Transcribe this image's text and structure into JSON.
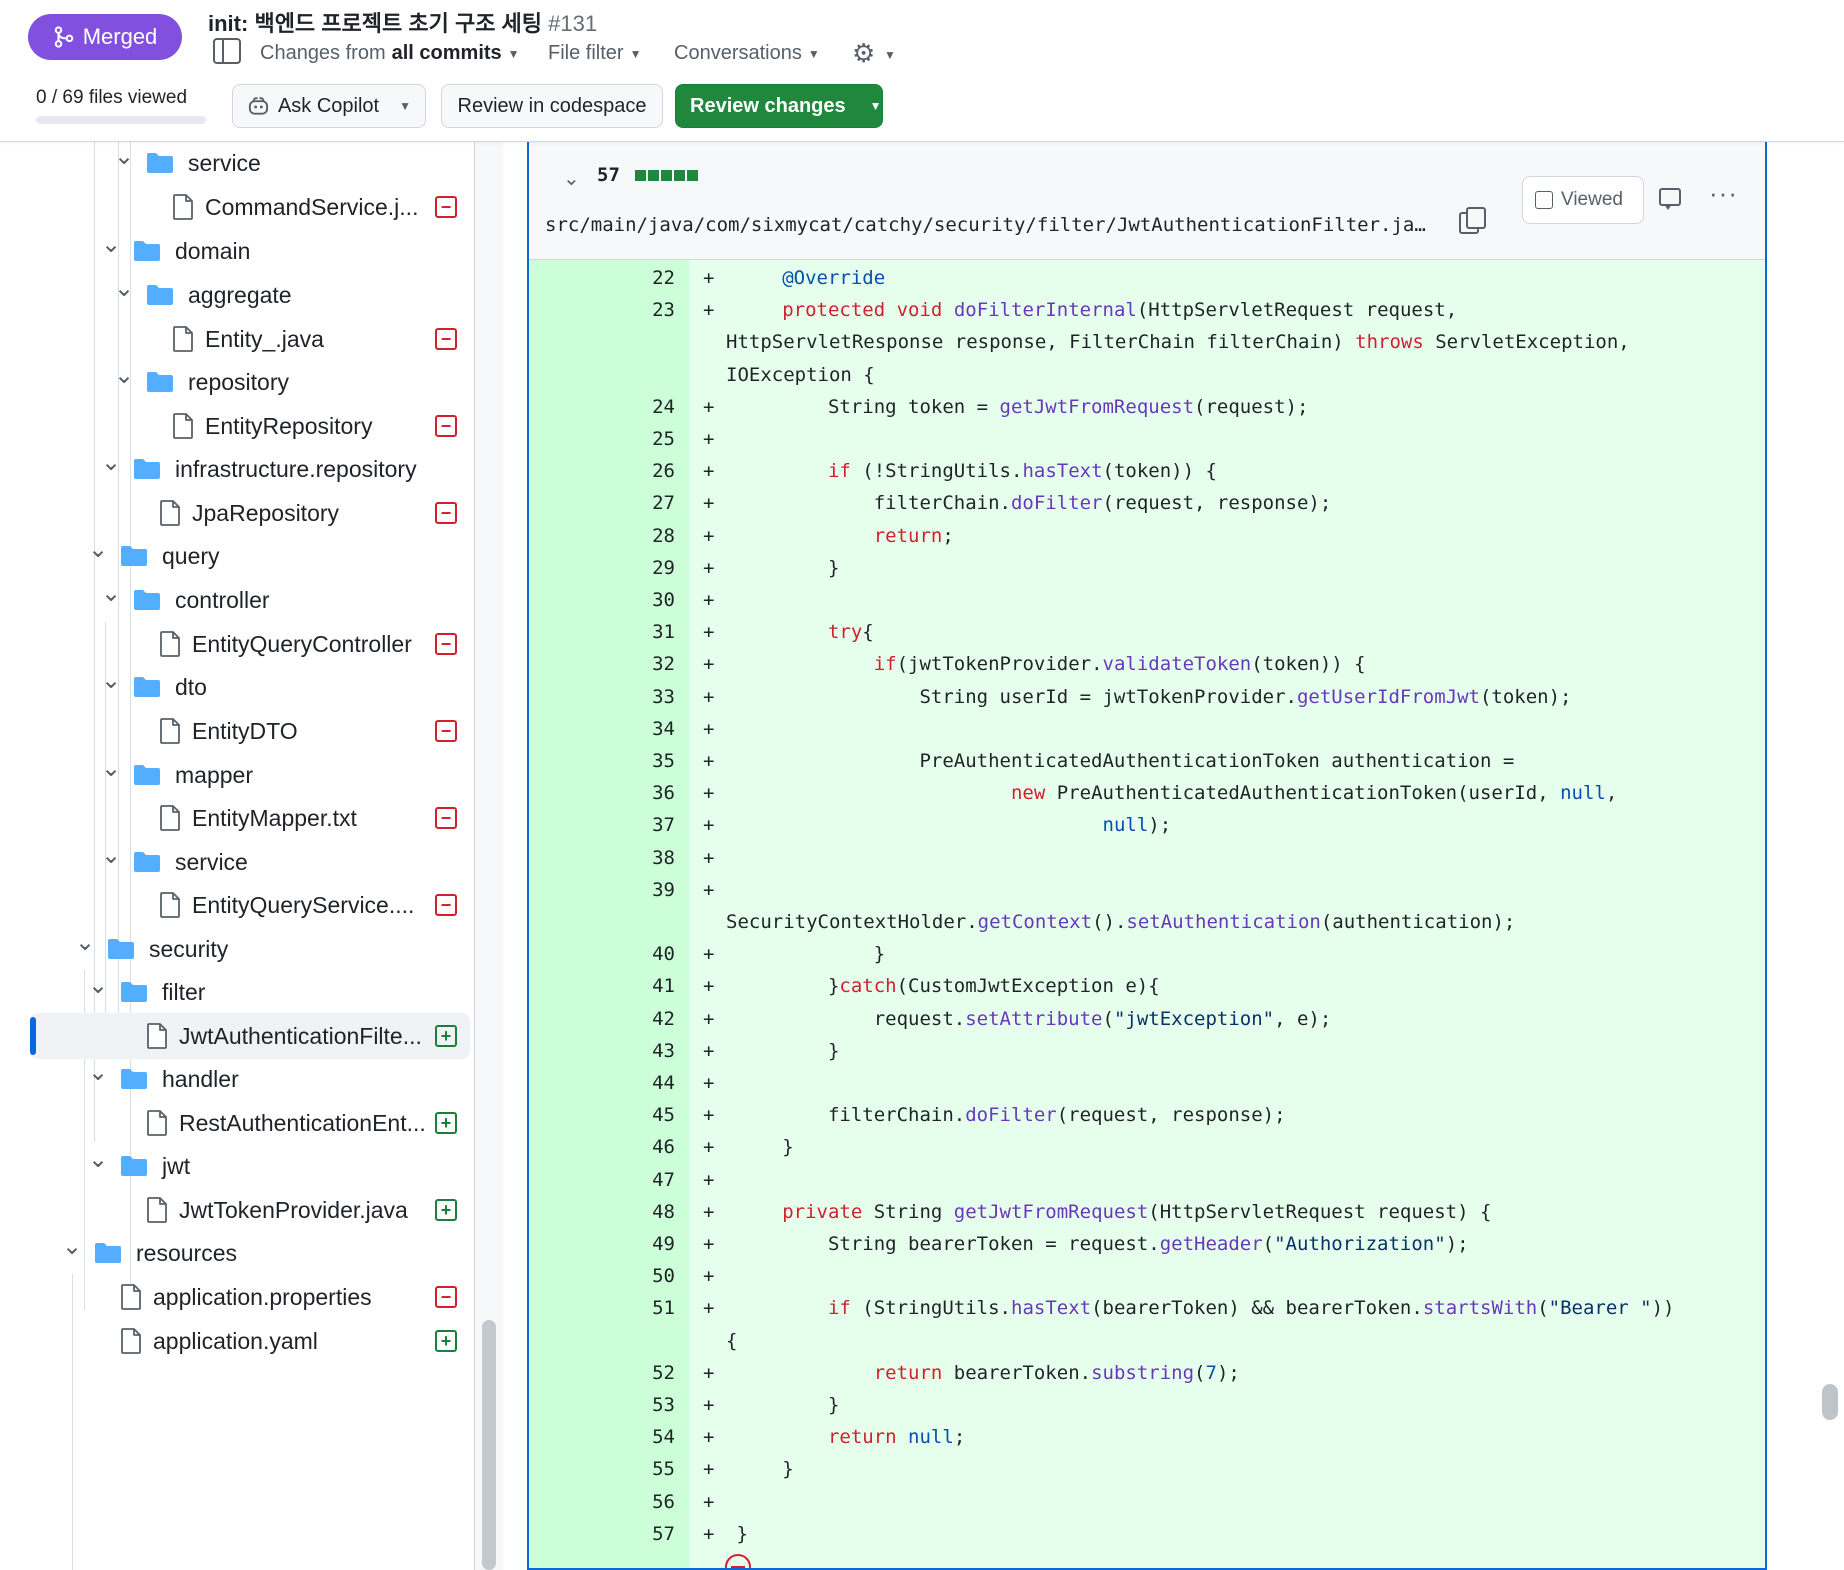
{
  "header": {
    "status_badge": "Merged",
    "title_prefix": "init:",
    "title_text": "백엔드 프로젝트 초기 구조 세팅",
    "pr_number": "#131",
    "changes_from_label": "Changes from",
    "changes_from_value": "all commits",
    "file_filter": "File filter",
    "conversations": "Conversations",
    "files_viewed": "0 / 69 files viewed",
    "ask_copilot": "Ask Copilot",
    "review_codespace": "Review in codespace",
    "review_changes": "Review changes",
    "files_viewed_fraction": 0
  },
  "tree": {
    "items": [
      {
        "label": "service",
        "type": "folder"
      },
      {
        "label": "CommandService.j...",
        "type": "file",
        "status": "deleted"
      },
      {
        "label": "domain",
        "type": "folder"
      },
      {
        "label": "aggregate",
        "type": "folder"
      },
      {
        "label": "Entity_.java",
        "type": "file",
        "status": "deleted"
      },
      {
        "label": "repository",
        "type": "folder"
      },
      {
        "label": "EntityRepository",
        "type": "file",
        "status": "deleted"
      },
      {
        "label": "infrastructure.repository",
        "type": "folder"
      },
      {
        "label": "JpaRepository",
        "type": "file",
        "status": "deleted"
      },
      {
        "label": "query",
        "type": "folder"
      },
      {
        "label": "controller",
        "type": "folder"
      },
      {
        "label": "EntityQueryController",
        "type": "file",
        "status": "deleted"
      },
      {
        "label": "dto",
        "type": "folder"
      },
      {
        "label": "EntityDTO",
        "type": "file",
        "status": "deleted"
      },
      {
        "label": "mapper",
        "type": "folder"
      },
      {
        "label": "EntityMapper.txt",
        "type": "file",
        "status": "deleted"
      },
      {
        "label": "service",
        "type": "folder"
      },
      {
        "label": "EntityQueryService....",
        "type": "file",
        "status": "deleted"
      },
      {
        "label": "security",
        "type": "folder"
      },
      {
        "label": "filter",
        "type": "folder"
      },
      {
        "label": "JwtAuthenticationFilte...",
        "type": "file",
        "status": "added",
        "selected": true
      },
      {
        "label": "handler",
        "type": "folder"
      },
      {
        "label": "RestAuthenticationEnt...",
        "type": "file",
        "status": "added"
      },
      {
        "label": "jwt",
        "type": "folder"
      },
      {
        "label": "JwtTokenProvider.java",
        "type": "file",
        "status": "added"
      },
      {
        "label": "resources",
        "type": "folder"
      },
      {
        "label": "application.properties",
        "type": "file",
        "status": "deleted"
      },
      {
        "label": "application.yaml",
        "type": "file",
        "status": "added"
      }
    ]
  },
  "diff": {
    "changed_lines": "57",
    "file_path": "src/main/java/com/sixmycat/catchy/security/filter/JwtAuthenticationFilter.ja…",
    "viewed_label": "Viewed",
    "lines": [
      {
        "n": "22",
        "code": "    @Override"
      },
      {
        "n": "23",
        "code": "    protected void doFilterInternal(HttpServletRequest request,"
      },
      {
        "n": "",
        "code": "HttpServletResponse response, FilterChain filterChain) throws ServletException,"
      },
      {
        "n": "",
        "code": "IOException {"
      },
      {
        "n": "24",
        "code": "        String token = getJwtFromRequest(request);"
      },
      {
        "n": "25",
        "code": ""
      },
      {
        "n": "26",
        "code": "        if (!StringUtils.hasText(token)) {"
      },
      {
        "n": "27",
        "code": "            filterChain.doFilter(request, response);"
      },
      {
        "n": "28",
        "code": "            return;"
      },
      {
        "n": "29",
        "code": "        }"
      },
      {
        "n": "30",
        "code": ""
      },
      {
        "n": "31",
        "code": "        try{"
      },
      {
        "n": "32",
        "code": "            if(jwtTokenProvider.validateToken(token)) {"
      },
      {
        "n": "33",
        "code": "                String userId = jwtTokenProvider.getUserIdFromJwt(token);"
      },
      {
        "n": "34",
        "code": ""
      },
      {
        "n": "35",
        "code": "                PreAuthenticatedAuthenticationToken authentication ="
      },
      {
        "n": "36",
        "code": "                        new PreAuthenticatedAuthenticationToken(userId, null,"
      },
      {
        "n": "37",
        "code": "                                null);"
      },
      {
        "n": "38",
        "code": ""
      },
      {
        "n": "39",
        "code": ""
      },
      {
        "n": "",
        "code": "SecurityContextHolder.getContext().setAuthentication(authentication);"
      },
      {
        "n": "40",
        "code": "            }"
      },
      {
        "n": "41",
        "code": "        }catch(CustomJwtException e){"
      },
      {
        "n": "42",
        "code": "            request.setAttribute(\"jwtException\", e);"
      },
      {
        "n": "43",
        "code": "        }"
      },
      {
        "n": "44",
        "code": ""
      },
      {
        "n": "45",
        "code": "        filterChain.doFilter(request, response);"
      },
      {
        "n": "46",
        "code": "    }"
      },
      {
        "n": "47",
        "code": ""
      },
      {
        "n": "48",
        "code": "    private String getJwtFromRequest(HttpServletRequest request) {"
      },
      {
        "n": "49",
        "code": "        String bearerToken = request.getHeader(\"Authorization\");"
      },
      {
        "n": "50",
        "code": ""
      },
      {
        "n": "51",
        "code": "        if (StringUtils.hasText(bearerToken) && bearerToken.startsWith(\"Bearer \"))"
      },
      {
        "n": "",
        "code": "{"
      },
      {
        "n": "52",
        "code": "            return bearerToken.substring(7);"
      },
      {
        "n": "53",
        "code": "        }"
      },
      {
        "n": "54",
        "code": "        return null;"
      },
      {
        "n": "55",
        "code": "    }"
      },
      {
        "n": "56",
        "code": ""
      },
      {
        "n": "57",
        "code": "}"
      }
    ]
  },
  "colors": {
    "merged": "#8250df",
    "review_green": "#1f883d",
    "deleted": "#cf222e",
    "added": "#1a7f37",
    "focus_blue": "#0969da",
    "diff_add_bg": "#e6ffec",
    "diff_add_gutter": "#ccffd8"
  }
}
